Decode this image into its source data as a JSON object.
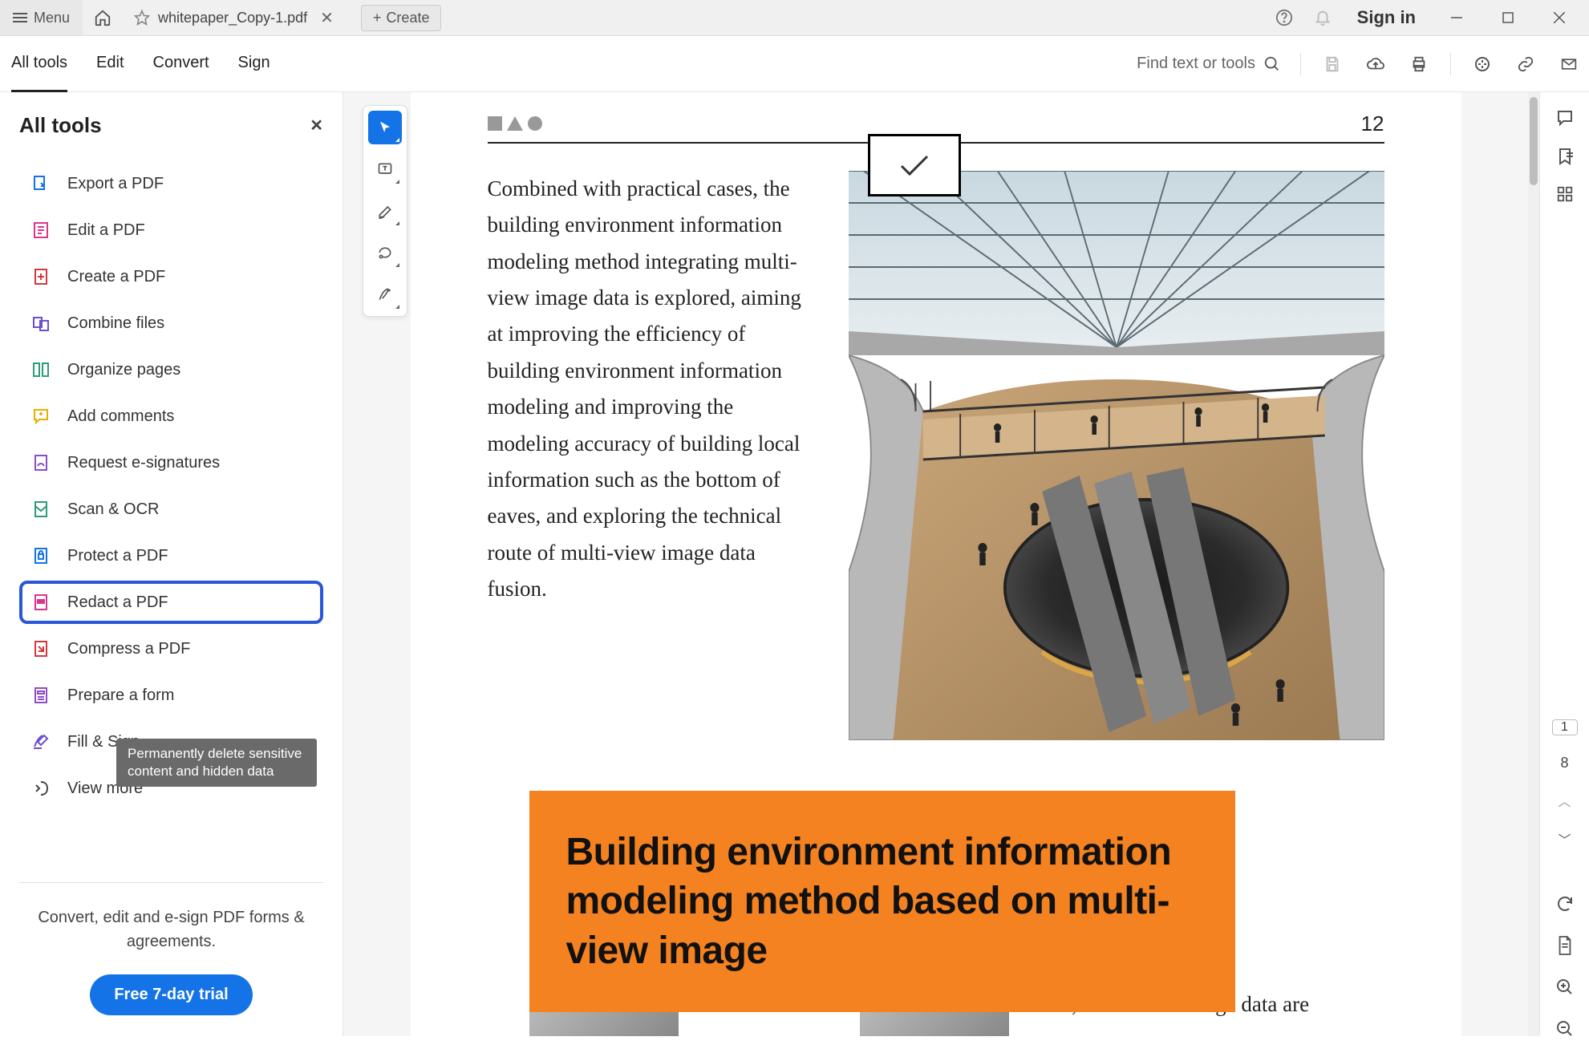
{
  "titlebar": {
    "menu": "Menu",
    "tab_name": "whitepaper_Copy-1.pdf",
    "create": "Create",
    "signin": "Sign in"
  },
  "toolbar": {
    "items": [
      "All tools",
      "Edit",
      "Convert",
      "Sign"
    ],
    "search_placeholder": "Find text or tools"
  },
  "sidebar": {
    "title": "All tools",
    "items": [
      {
        "label": "Export a PDF",
        "color": "#1473e6"
      },
      {
        "label": "Edit a PDF",
        "color": "#d83790"
      },
      {
        "label": "Create a PDF",
        "color": "#d7373f"
      },
      {
        "label": "Combine files",
        "color": "#6b4ed1"
      },
      {
        "label": "Organize pages",
        "color": "#2d9d78"
      },
      {
        "label": "Add comments",
        "color": "#e6b000"
      },
      {
        "label": "Request e-signatures",
        "color": "#8e4ec6"
      },
      {
        "label": "Scan & OCR",
        "color": "#2d9d78"
      },
      {
        "label": "Protect a PDF",
        "color": "#1473e6"
      },
      {
        "label": "Redact a PDF",
        "color": "#d83790"
      },
      {
        "label": "Compress a PDF",
        "color": "#d7373f"
      },
      {
        "label": "Prepare a form",
        "color": "#8e4ec6"
      },
      {
        "label": "Fill & Sign",
        "color": "#6b4ed1"
      },
      {
        "label": "View more",
        "color": "#444"
      }
    ],
    "highlighted_index": 9,
    "tooltip": "Permanently delete sensitive content and hidden data",
    "footer_text": "Convert, edit and e-sign PDF forms & agreements.",
    "trial_button": "Free 7-day trial"
  },
  "document": {
    "page_number": "12",
    "body_text": "Combined with practical cases, the building environment information modeling method integrating multi-view image data is explored, aiming at improving the efficiency of building environment information modeling and improving the modeling accuracy of building local information such as the bottom of eaves, and exploring the technical route of multi-view image data fusion.",
    "orange_heading": "Building environment information modeling method based on multi-view image",
    "bottom_text": "constructed, multi-view image data are"
  },
  "rightrail": {
    "current_page": "1",
    "total_pages": "8"
  }
}
